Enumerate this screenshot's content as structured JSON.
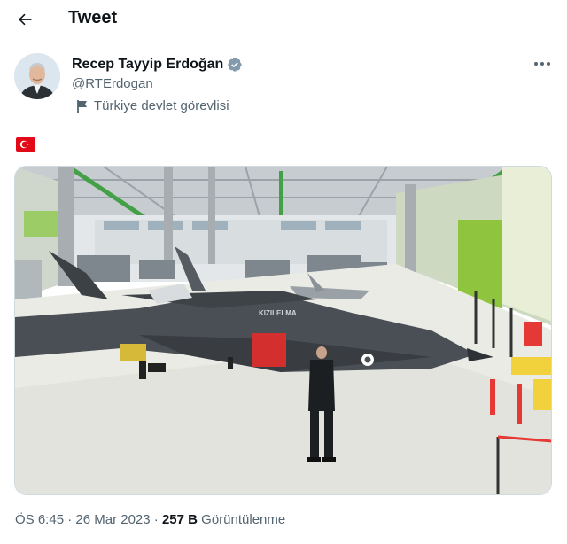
{
  "header": {
    "title": "Tweet",
    "back_icon": "arrow-left-icon"
  },
  "author": {
    "name": "Recep Tayyip Erdoğan",
    "handle": "@RTErdogan",
    "verified_icon": "verified-badge-icon",
    "affiliation_label": "Türkiye devlet görevlisi",
    "affiliation_icon": "flag-icon"
  },
  "tweet": {
    "emoji": "turkey-flag-emoji",
    "media_description_icon": "photo",
    "aircraft_marking": "KIZILELMA"
  },
  "meta": {
    "time": "ÖS 6:45",
    "separator": "·",
    "date": "26 Mar 2023",
    "views_count": "257 B",
    "views_label": "Görüntülenme"
  },
  "colors": {
    "text_primary": "#0f1419",
    "text_secondary": "#536471",
    "verified": "#829aab",
    "flag_red": "#e30a17"
  }
}
